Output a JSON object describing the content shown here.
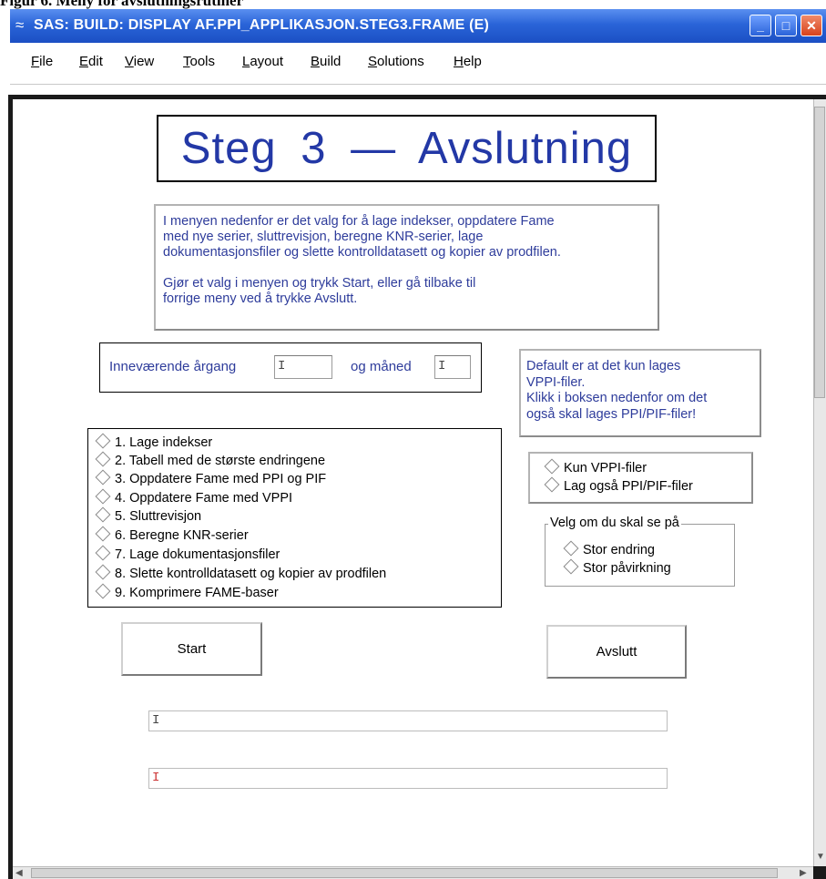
{
  "caption": "Figur 6. Meny for avslutningsrutiner",
  "window": {
    "title": "SAS: BUILD: DISPLAY AF.PPI_APPLIKASJON.STEG3.FRAME (E)",
    "minimize_glyph": "_",
    "maximize_glyph": "□",
    "close_glyph": "✕"
  },
  "menubar": [
    "File",
    "Edit",
    "View",
    "Tools",
    "Layout",
    "Build",
    "Solutions",
    "Help"
  ],
  "heading": "Steg 3  —  Avslutning",
  "info_text": "I menyen nedenfor er det valg for å lage indekser, oppdatere Fame\nmed nye serier, sluttrevisjon, beregne KNR-serier, lage\ndokumentasjonsfiler og slette kontrolldatasett og kopier av prodfilen.\n\nGjør et valg i menyen og trykk Start, eller gå tilbake til\nforrige meny ved å trykke Avslutt.",
  "year_label": "Inneværende årgang",
  "month_label": "og måned",
  "year_value": "",
  "month_value": "",
  "default_note": "Default er at det kun lages\nVPPI-filer.\nKlikk i boksen nedenfor om det\nogså skal lages PPI/PIF-filer!",
  "menu_options": [
    "1. Lage indekser",
    "2. Tabell med de største endringene",
    "3. Oppdatere Fame med PPI og PIF",
    "4. Oppdatere Fame med VPPI",
    "5. Sluttrevisjon",
    "6. Beregne KNR-serier",
    "7. Lage dokumentasjonsfiler",
    "8. Slette kontrolldatasett og kopier av prodfilen",
    "9. Komprimere FAME-baser"
  ],
  "file_options": [
    "Kun VPPI-filer",
    "Lag også PPI/PIF-filer"
  ],
  "view_group": {
    "legend": "Velg om du skal se på",
    "options": [
      "Stor endring",
      "Stor påvirkning"
    ]
  },
  "buttons": {
    "start": "Start",
    "exit": "Avslutt"
  },
  "message_field_1": "",
  "message_field_2": "",
  "colors": {
    "heading": "#2338a6",
    "body_text": "#2e3c9b",
    "titlebar": "#2a64d8"
  }
}
